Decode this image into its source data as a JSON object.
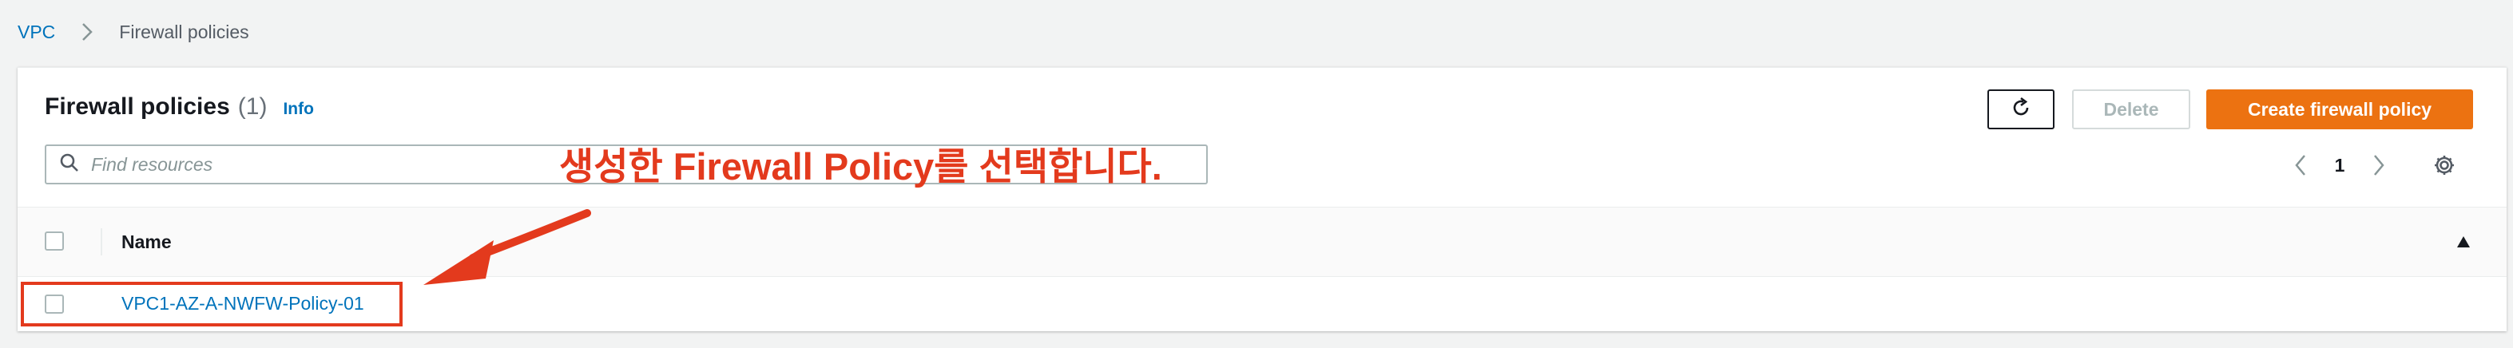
{
  "breadcrumb": {
    "root": "VPC",
    "current": "Firewall policies"
  },
  "panel": {
    "title": "Firewall policies",
    "count": "(1)",
    "info": "Info",
    "actions": {
      "delete_label": "Delete",
      "create_label": "Create firewall policy"
    }
  },
  "search": {
    "placeholder": "Find resources",
    "value": ""
  },
  "pagination": {
    "current_page": "1"
  },
  "table": {
    "columns": [
      "Name"
    ],
    "rows": [
      {
        "name": "VPC1-AZ-A-NWFW-Policy-01",
        "selected": false
      }
    ]
  },
  "annotation": {
    "text": "생성한 Firewall Policy를 선택합니다."
  },
  "colors": {
    "link": "#0073bb",
    "primary": "#ec7211",
    "annotation": "#e33a1d",
    "background": "#f2f3f3"
  },
  "icons": [
    "chevron-right-icon",
    "refresh-icon",
    "search-icon",
    "chevron-left-icon",
    "gear-icon",
    "sort-up-icon",
    "arrow-icon"
  ]
}
